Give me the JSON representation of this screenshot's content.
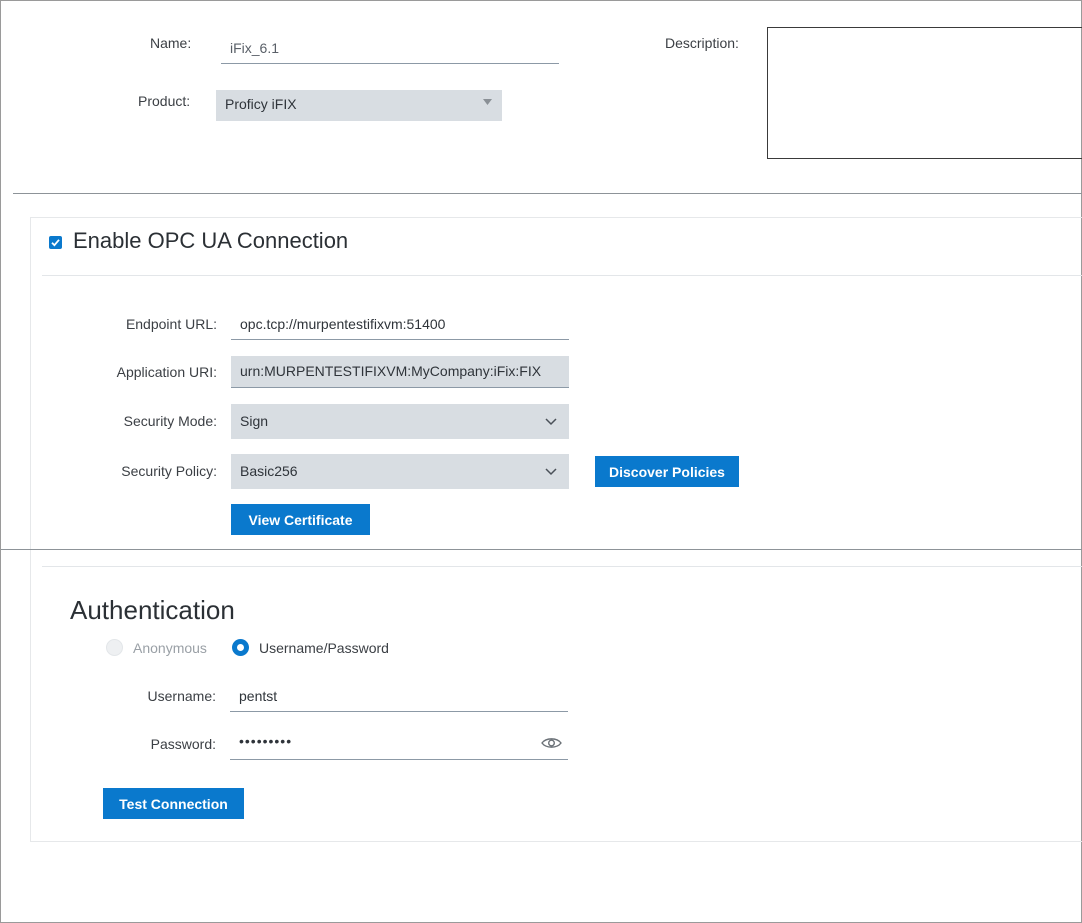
{
  "general": {
    "name_label": "Name:",
    "name_value": "iFix_6.1",
    "product_label": "Product:",
    "product_value": "Proficy iFIX",
    "description_label": "Description:",
    "description_value": ""
  },
  "opcua": {
    "enable_label": "Enable OPC UA Connection",
    "enabled": true,
    "endpoint_label": "Endpoint URL:",
    "endpoint_value": "opc.tcp://murpentestifixvm:51400",
    "app_uri_label": "Application URI:",
    "app_uri_value": "urn:MURPENTESTIFIXVM:MyCompany:iFix:FIX",
    "security_mode_label": "Security Mode:",
    "security_mode_value": "Sign",
    "security_policy_label": "Security Policy:",
    "security_policy_value": "Basic256",
    "discover_button": "Discover Policies",
    "view_cert_button": "View Certificate"
  },
  "auth": {
    "title": "Authentication",
    "anonymous_label": "Anonymous",
    "userpass_label": "Username/Password",
    "selected": "Username/Password",
    "username_label": "Username:",
    "username_value": "pentst",
    "password_label": "Password:",
    "password_value": "•••••••••",
    "test_button": "Test Connection"
  },
  "colors": {
    "accent": "#0a79cd",
    "field_grey": "#d8dde2"
  }
}
